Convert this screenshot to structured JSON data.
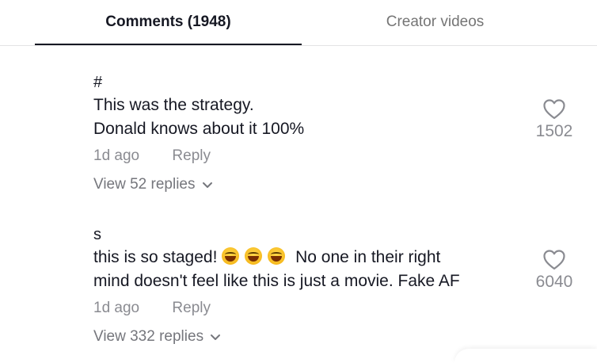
{
  "tabs": {
    "comments_label": "Comments (1948)",
    "creator_videos_label": "Creator videos"
  },
  "comments": [
    {
      "username": "#",
      "lines": [
        "This was the strategy.",
        "Donald knows about it 100%"
      ],
      "time": "1d ago",
      "reply_label": "Reply",
      "view_replies_label": "View 52 replies",
      "likes": "1502"
    },
    {
      "username": "s",
      "line1_before": "this is so staged!",
      "line1_after": "No one in their right",
      "line2": "mind doesn't feel like this is just a movie. Fake AF",
      "emoji_count": 3,
      "emoji_name": "laughing-tears-emoji",
      "time": "1d ago",
      "reply_label": "Reply",
      "view_replies_label": "View 332 replies",
      "likes": "6040"
    }
  ],
  "colors": {
    "text": "#161823",
    "muted": "#8a8b91",
    "tab_inactive": "#757575",
    "divider": "#e3e3e4"
  },
  "icons": {
    "like": "heart-outline-icon",
    "expand": "chevron-down-icon"
  }
}
